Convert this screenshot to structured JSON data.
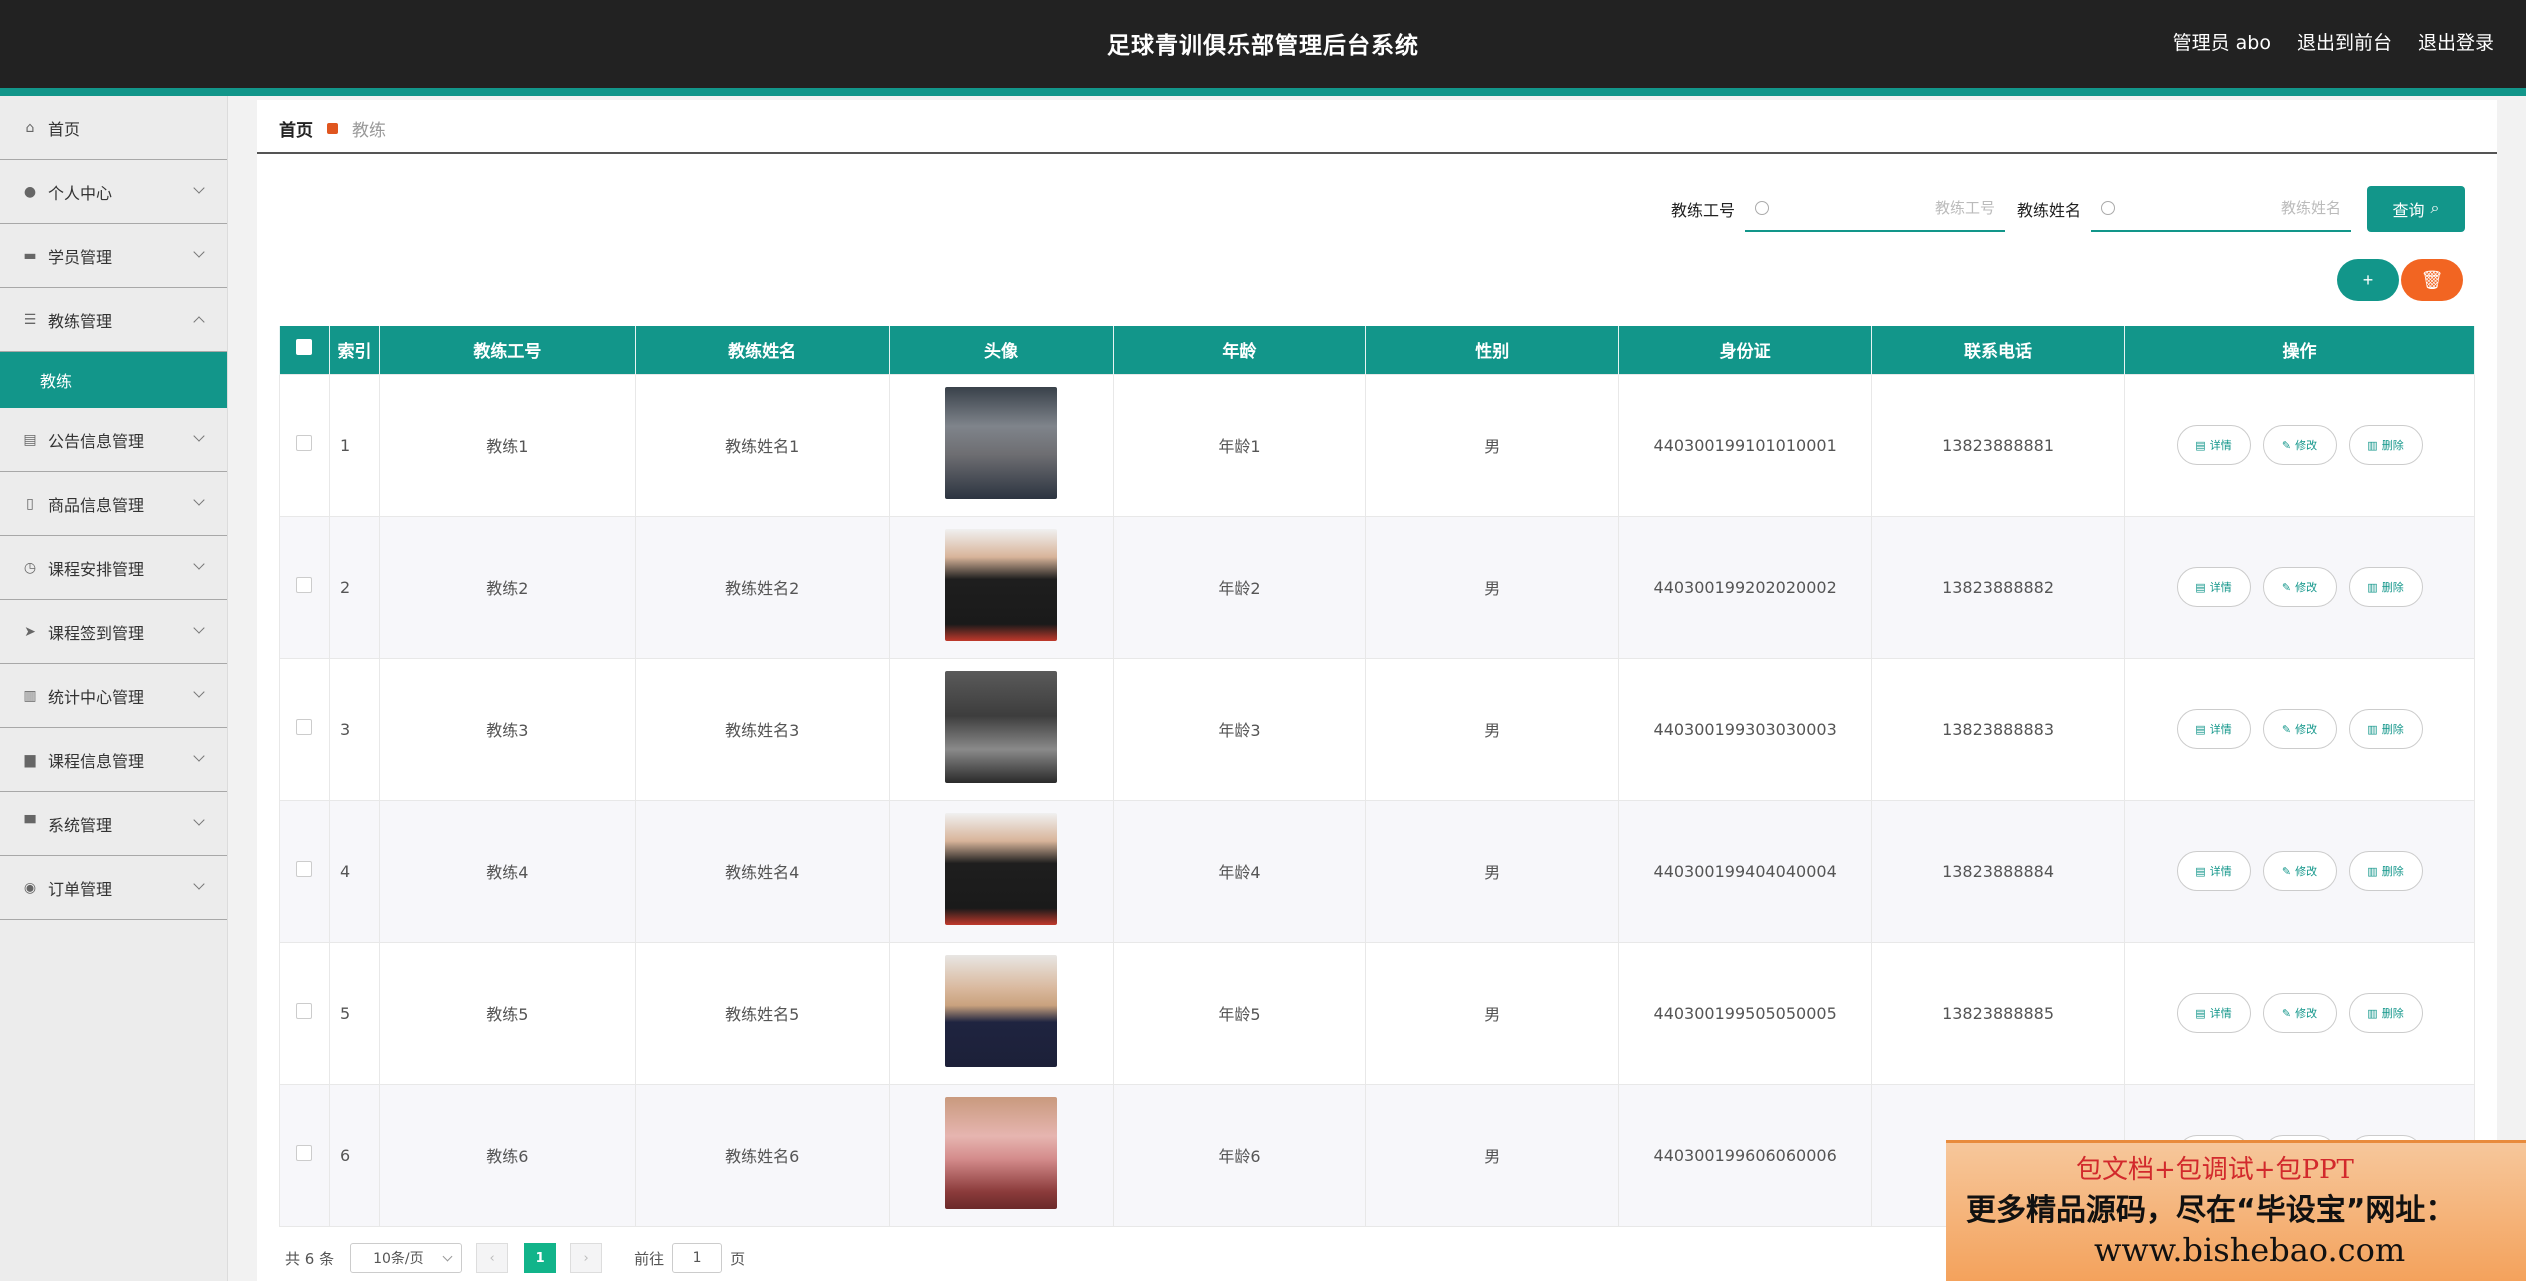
{
  "header": {
    "title": "足球青训俱乐部管理后台系统",
    "user": "管理员 abo",
    "to_front": "退出到前台",
    "logout": "退出登录"
  },
  "sidebar": {
    "items": [
      {
        "label": "首页",
        "icon": "home-icon"
      },
      {
        "label": "个人中心",
        "icon": "user-icon"
      },
      {
        "label": "学员管理",
        "icon": "ticket-icon"
      },
      {
        "label": "教练管理",
        "icon": "list-icon",
        "expanded": true
      },
      {
        "label": "公告信息管理",
        "icon": "clipboard-icon"
      },
      {
        "label": "商品信息管理",
        "icon": "mic-icon"
      },
      {
        "label": "课程安排管理",
        "icon": "clock-icon"
      },
      {
        "label": "课程签到管理",
        "icon": "send-icon"
      },
      {
        "label": "统计中心管理",
        "icon": "chart-icon"
      },
      {
        "label": "课程信息管理",
        "icon": "printer-icon"
      },
      {
        "label": "系统管理",
        "icon": "monitor-icon"
      },
      {
        "label": "订单管理",
        "icon": "map-pin-icon"
      }
    ],
    "sub_item": "教练"
  },
  "breadcrumb": {
    "home": "首页",
    "current": "教练"
  },
  "search": {
    "field1_label": "教练工号",
    "field1_placeholder": "教练工号",
    "field2_label": "教练姓名",
    "field2_placeholder": "教练姓名",
    "query_label": "查询"
  },
  "actions": {
    "add": "+",
    "delete": "🗑"
  },
  "table": {
    "headers": [
      "索引",
      "教练工号",
      "教练姓名",
      "头像",
      "年龄",
      "性别",
      "身份证",
      "联系电话",
      "操作"
    ],
    "rows": [
      {
        "idx": "1",
        "no": "教练1",
        "name": "教练姓名1",
        "age": "年龄1",
        "sex": "男",
        "id": "440300199101010001",
        "phone": "13823888881"
      },
      {
        "idx": "2",
        "no": "教练2",
        "name": "教练姓名2",
        "age": "年龄2",
        "sex": "男",
        "id": "440300199202020002",
        "phone": "13823888882"
      },
      {
        "idx": "3",
        "no": "教练3",
        "name": "教练姓名3",
        "age": "年龄3",
        "sex": "男",
        "id": "440300199303030003",
        "phone": "13823888883"
      },
      {
        "idx": "4",
        "no": "教练4",
        "name": "教练姓名4",
        "age": "年龄4",
        "sex": "男",
        "id": "440300199404040004",
        "phone": "13823888884"
      },
      {
        "idx": "5",
        "no": "教练5",
        "name": "教练姓名5",
        "age": "年龄5",
        "sex": "男",
        "id": "440300199505050005",
        "phone": "13823888885"
      },
      {
        "idx": "6",
        "no": "教练6",
        "name": "教练姓名6",
        "age": "年龄6",
        "sex": "男",
        "id": "440300199606060006",
        "phone": ""
      }
    ],
    "op_detail": "详情",
    "op_edit": "修改",
    "op_delete": "删除"
  },
  "pager": {
    "total": "共 6 条",
    "page_size": "10条/页",
    "current_page": "1",
    "goto_label": "前往",
    "goto_value": "1",
    "page_unit": "页"
  },
  "watermark": {
    "line1": "包文档+包调试+包PPT",
    "line2": "更多精品源码，尽在“毕设宝”网址：",
    "line3": "www.bishebao.com"
  },
  "colors": {
    "primary": "#12968a",
    "danger": "#f26522",
    "topbar": "#222222"
  }
}
